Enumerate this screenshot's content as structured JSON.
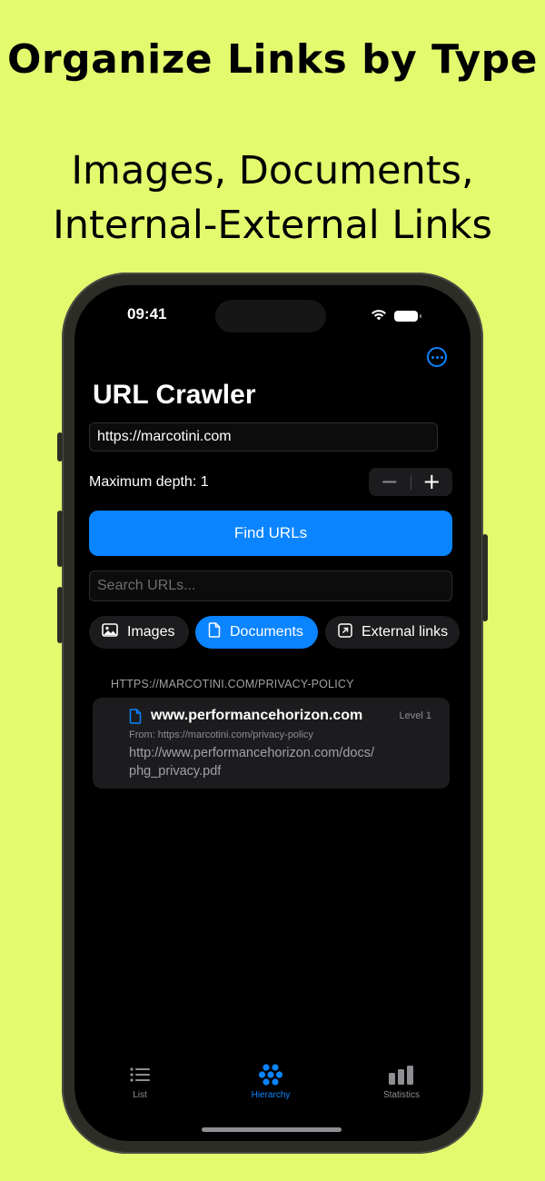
{
  "promo": {
    "headline": "Organize Links by Type",
    "subline_1": "Images, Documents,",
    "subline_2": "Internal-External Links"
  },
  "status_bar": {
    "time": "09:41",
    "icons": [
      "wifi-icon",
      "battery-icon"
    ]
  },
  "app": {
    "title": "URL Crawler",
    "more_icon": "ellipsis-circle-icon"
  },
  "form": {
    "url_value": "https://marcotini.com",
    "depth_label": "Maximum depth: 1",
    "stepper_minus": "−",
    "stepper_plus": "+",
    "find_button": "Find URLs",
    "search_placeholder": "Search URLs..."
  },
  "filters": [
    {
      "label": "Images",
      "icon": "photo-icon",
      "active": false
    },
    {
      "label": "Documents",
      "icon": "document-icon",
      "active": true
    },
    {
      "label": "External links",
      "icon": "arrow-up-right-square-icon",
      "active": false
    }
  ],
  "results": {
    "section_header": "HTTPS://MARCOTINI.COM/PRIVACY-POLICY",
    "items": [
      {
        "host": "www.performancehorizon.com",
        "level": "Level 1",
        "from": "From: https://marcotini.com/privacy-policy",
        "url_line_1": "http://www.performancehorizon.com/docs/",
        "url_line_2": "phg_privacy.pdf"
      }
    ]
  },
  "tabbar": {
    "tabs": [
      {
        "label": "List",
        "icon": "list-icon",
        "active": false
      },
      {
        "label": "Hierarchy",
        "icon": "hierarchy-icon",
        "active": true
      },
      {
        "label": "Statistics",
        "icon": "chart-bar-icon",
        "active": false
      }
    ]
  },
  "colors": {
    "background": "#e3fa6e",
    "accent": "#0a84ff",
    "screen": "#000000",
    "card": "#1c1c1e"
  }
}
